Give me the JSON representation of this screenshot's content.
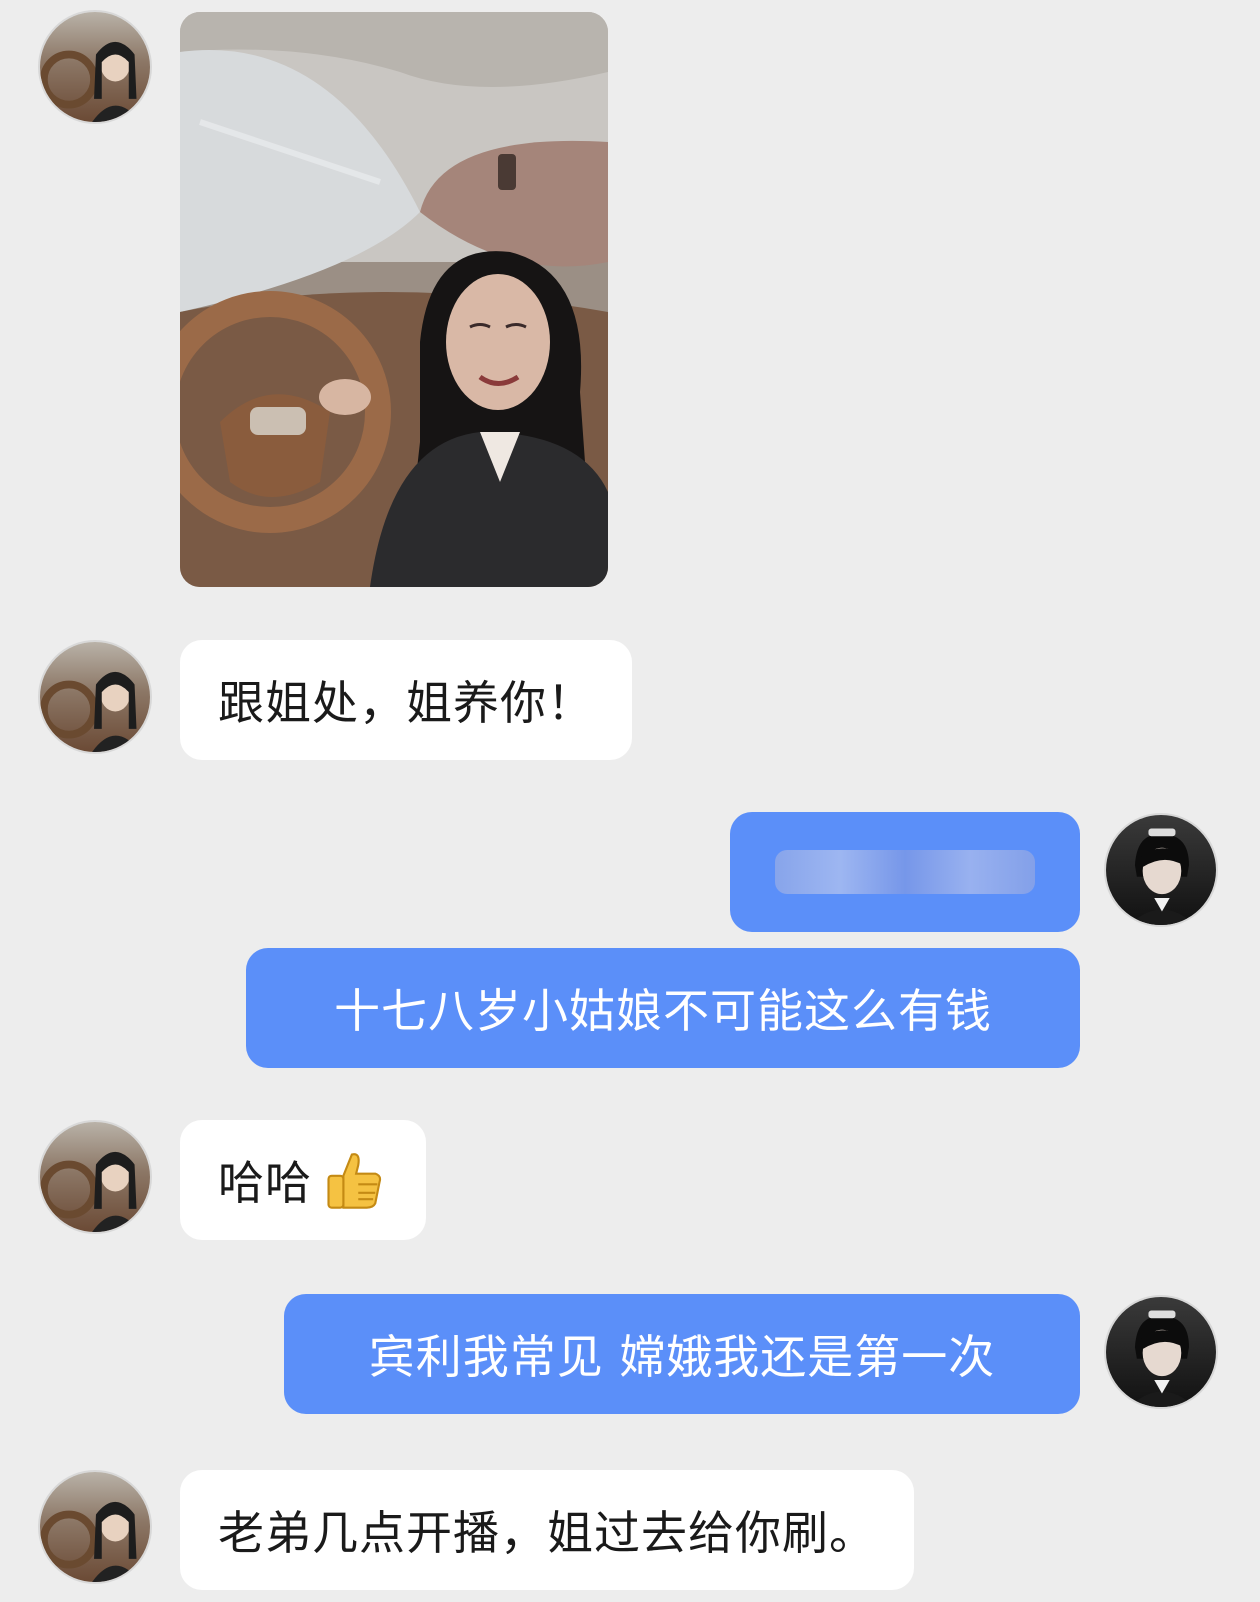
{
  "messages": [
    {
      "sender": "sister",
      "type": "image"
    },
    {
      "sender": "sister",
      "type": "text",
      "text": "跟姐处，姐养你！"
    },
    {
      "sender": "me",
      "type": "blurred"
    },
    {
      "sender": "me",
      "type": "text",
      "text": "十七八岁小姑娘不可能这么有钱"
    },
    {
      "sender": "sister",
      "type": "text",
      "text": "哈哈"
    },
    {
      "sender": "me",
      "type": "text",
      "text": "宾利我常见 嫦娥我还是第一次"
    },
    {
      "sender": "sister",
      "type": "text",
      "text": "老弟几点开播，姐过去给你刷。"
    }
  ],
  "icons": {
    "reaction": "thumbs-up-icon"
  },
  "colors": {
    "background": "#ededed",
    "incoming_bubble": "#ffffff",
    "outgoing_bubble": "#5b8ff9",
    "incoming_text": "#1a1a1a",
    "outgoing_text": "#ffffff"
  }
}
